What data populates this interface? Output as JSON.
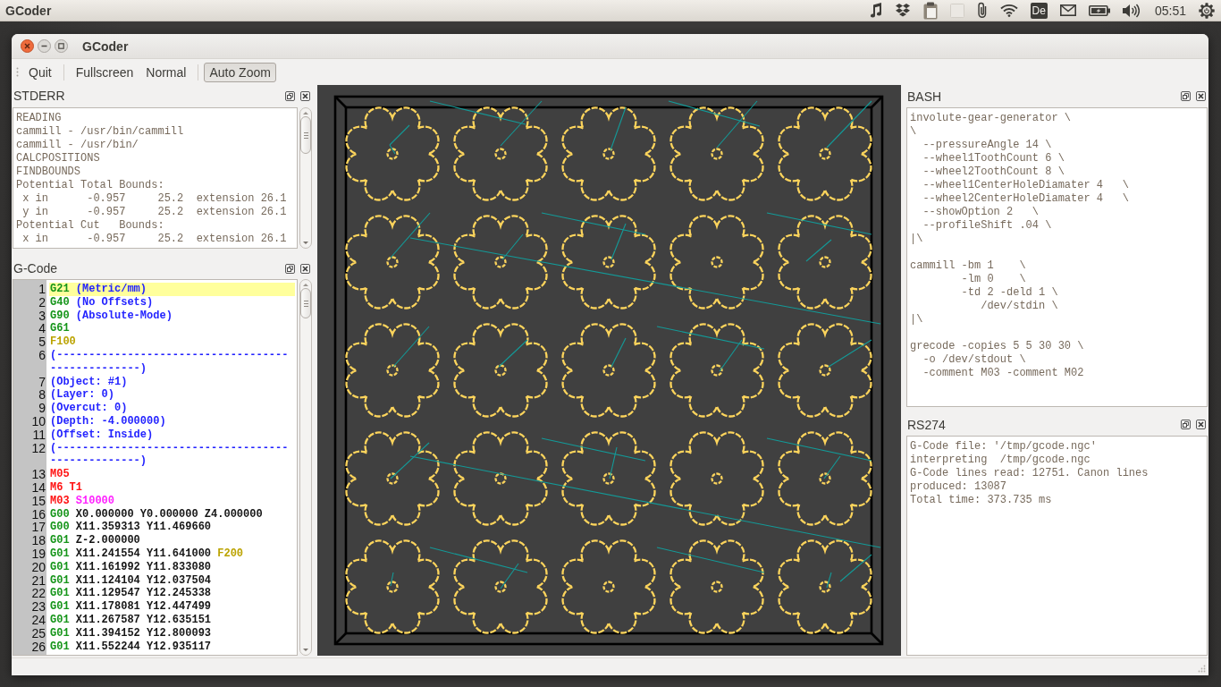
{
  "top_panel": {
    "app_name": "GCoder",
    "keyboard_layout": "De",
    "clock": "05:51"
  },
  "window": {
    "title": "GCoder"
  },
  "toolbar": {
    "groups": [
      {
        "buttons": [
          {
            "label": "Quit",
            "checked": false
          }
        ]
      },
      {
        "buttons": [
          {
            "label": "Fullscreen",
            "checked": false
          },
          {
            "label": "Normal",
            "checked": false
          }
        ]
      },
      {
        "buttons": [
          {
            "label": "Auto Zoom",
            "checked": true
          }
        ]
      }
    ]
  },
  "stderr_dock": {
    "title": "STDERR",
    "lines": [
      "READING",
      "cammill - /usr/bin/cammill",
      "cammill - /usr/bin/",
      "CALCPOSITIONS",
      "FINDBOUNDS",
      "Potential Total Bounds:",
      " x in      -0.957     25.2  extension 26.1",
      " y in      -0.957     25.2  extension 26.1",
      "Potential Cut   Bounds:",
      " x in      -0.957     25.2  extension 26.1"
    ]
  },
  "gcode_dock": {
    "title": "G-Code",
    "lines": [
      {
        "number": "1",
        "selected": true,
        "tokens": [
          {
            "text": "G21",
            "kind": "gcode"
          },
          {
            "text": "(Metric/mm)",
            "kind": "comment"
          }
        ]
      },
      {
        "number": "2",
        "selected": false,
        "tokens": [
          {
            "text": "G40",
            "kind": "gcode"
          },
          {
            "text": "(No Offsets)",
            "kind": "comment"
          }
        ]
      },
      {
        "number": "3",
        "selected": false,
        "tokens": [
          {
            "text": "G90",
            "kind": "gcode"
          },
          {
            "text": "(Absolute-Mode)",
            "kind": "comment"
          }
        ]
      },
      {
        "number": "4",
        "selected": false,
        "tokens": [
          {
            "text": "G61",
            "kind": "gcode"
          }
        ]
      },
      {
        "number": "5",
        "selected": false,
        "tokens": [
          {
            "text": "F100",
            "kind": "feed"
          }
        ]
      },
      {
        "number": "6",
        "selected": false,
        "tokens": [
          {
            "text": "(--------------------------------------------------)",
            "kind": "comment"
          }
        ]
      },
      {
        "number": "7",
        "selected": false,
        "tokens": [
          {
            "text": "(Object: #1)",
            "kind": "comment"
          }
        ]
      },
      {
        "number": "8",
        "selected": false,
        "tokens": [
          {
            "text": "(Layer: 0)",
            "kind": "comment"
          }
        ]
      },
      {
        "number": "9",
        "selected": false,
        "tokens": [
          {
            "text": "(Overcut: 0)",
            "kind": "comment"
          }
        ]
      },
      {
        "number": "10",
        "selected": false,
        "tokens": [
          {
            "text": "(Depth: -4.000000)",
            "kind": "comment"
          }
        ]
      },
      {
        "number": "11",
        "selected": false,
        "tokens": [
          {
            "text": "(Offset: Inside)",
            "kind": "comment"
          }
        ]
      },
      {
        "number": "12",
        "selected": false,
        "tokens": [
          {
            "text": "(--------------------------------------------------)",
            "kind": "comment"
          }
        ]
      },
      {
        "number": "13",
        "selected": false,
        "tokens": [
          {
            "text": "M05",
            "kind": "mcode"
          }
        ]
      },
      {
        "number": "14",
        "selected": false,
        "tokens": [
          {
            "text": "M6",
            "kind": "mcode"
          },
          {
            "text": "T1",
            "kind": "mcode"
          }
        ]
      },
      {
        "number": "15",
        "selected": false,
        "tokens": [
          {
            "text": "M03",
            "kind": "mcode"
          },
          {
            "text": "S10000",
            "kind": "spindle"
          }
        ]
      },
      {
        "number": "16",
        "selected": false,
        "tokens": [
          {
            "text": "G00",
            "kind": "gcode"
          },
          {
            "text": "X0.000000 Y0.000000 Z4.000000",
            "kind": "coord"
          }
        ]
      },
      {
        "number": "17",
        "selected": false,
        "tokens": [
          {
            "text": "G00",
            "kind": "gcode"
          },
          {
            "text": "X11.359313 Y11.469660",
            "kind": "coord"
          }
        ]
      },
      {
        "number": "18",
        "selected": false,
        "tokens": [
          {
            "text": "G01",
            "kind": "gcode"
          },
          {
            "text": "Z-2.000000",
            "kind": "coord"
          }
        ]
      },
      {
        "number": "19",
        "selected": false,
        "tokens": [
          {
            "text": "G01",
            "kind": "gcode"
          },
          {
            "text": "X11.241554 Y11.641000",
            "kind": "coord"
          },
          {
            "text": "F200",
            "kind": "feed"
          }
        ]
      },
      {
        "number": "20",
        "selected": false,
        "tokens": [
          {
            "text": "G01",
            "kind": "gcode"
          },
          {
            "text": "X11.161992 Y11.833080",
            "kind": "coord"
          }
        ]
      },
      {
        "number": "21",
        "selected": false,
        "tokens": [
          {
            "text": "G01",
            "kind": "gcode"
          },
          {
            "text": "X11.124104 Y12.037504",
            "kind": "coord"
          }
        ]
      },
      {
        "number": "22",
        "selected": false,
        "tokens": [
          {
            "text": "G01",
            "kind": "gcode"
          },
          {
            "text": "X11.129547 Y12.245338",
            "kind": "coord"
          }
        ]
      },
      {
        "number": "23",
        "selected": false,
        "tokens": [
          {
            "text": "G01",
            "kind": "gcode"
          },
          {
            "text": "X11.178081 Y12.447499",
            "kind": "coord"
          }
        ]
      },
      {
        "number": "24",
        "selected": false,
        "tokens": [
          {
            "text": "G01",
            "kind": "gcode"
          },
          {
            "text": "X11.267587 Y12.635151",
            "kind": "coord"
          }
        ]
      },
      {
        "number": "25",
        "selected": false,
        "tokens": [
          {
            "text": "G01",
            "kind": "gcode"
          },
          {
            "text": "X11.394152 Y12.800093",
            "kind": "coord"
          }
        ]
      },
      {
        "number": "26",
        "selected": false,
        "tokens": [
          {
            "text": "G01",
            "kind": "gcode"
          },
          {
            "text": "X11.552244 Y12.935117",
            "kind": "coord"
          }
        ]
      }
    ]
  },
  "bash_dock": {
    "title": "BASH",
    "blocks": [
      [
        "involute-gear-generator \\",
        "\\",
        "  --pressureAngle 14 \\",
        "  --wheel1ToothCount 6 \\",
        "  --wheel2ToothCount 8 \\",
        "  --wheel1CenterHoleDiamater 4   \\",
        "  --wheel2CenterHoleDiamater 4   \\",
        "  --showOption 2   \\",
        "  --profileShift .04 \\",
        "|\\"
      ],
      [
        "cammill -bm 1    \\",
        "        -lm 0    \\",
        "        -td 2 -deld 1 \\",
        "           /dev/stdin \\",
        "|\\"
      ],
      [
        "grecode -copies 5 5 30 30 \\",
        "  -o /dev/stdout \\",
        "  -comment M03 -comment M02"
      ]
    ]
  },
  "rs274_dock": {
    "title": "RS274",
    "lines": [
      "G-Code file: '/tmp/gcode.ngc'",
      "interpreting  /tmp/gcode.ngc",
      "G-Code lines read: 12751. Canon lines",
      "produced: 13087",
      "Total time: 373.735 ms"
    ]
  }
}
